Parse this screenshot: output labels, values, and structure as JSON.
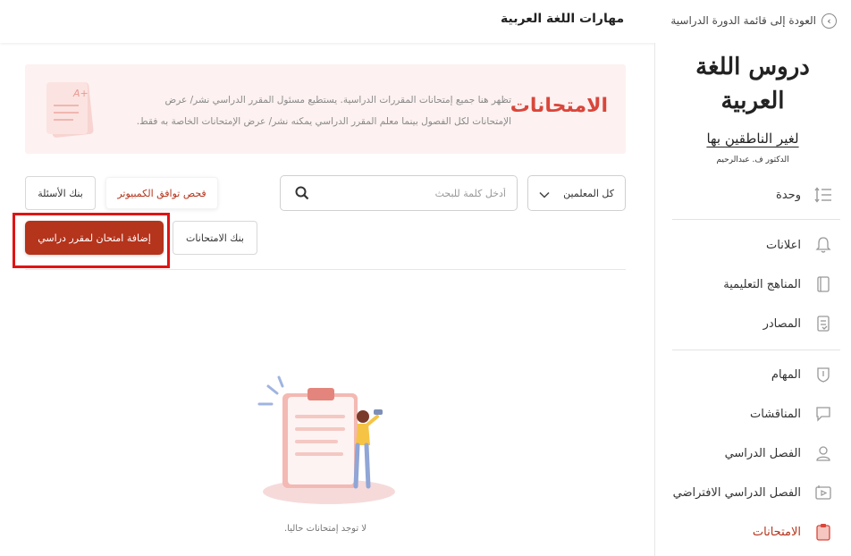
{
  "header": {
    "back_label": "العودة إلى قائمة الدورة الدراسية",
    "course_title": "مهارات اللغة العربية"
  },
  "logo": {
    "main_text": "دروس اللغة العربية",
    "sub_text": "لغير الناطقين بها",
    "author": "الدكتور ف. عبدالرحيم"
  },
  "sidebar": {
    "items": [
      {
        "label": "وحدة",
        "icon": "list-order-icon"
      },
      {
        "label": "اعلانات",
        "icon": "bell-icon"
      },
      {
        "label": "المناهج التعليمية",
        "icon": "book-icon"
      },
      {
        "label": "المصادر",
        "icon": "resources-icon"
      },
      {
        "label": "المهام",
        "icon": "shield-icon"
      },
      {
        "label": "المناقشات",
        "icon": "chat-icon"
      },
      {
        "label": "الفصل الدراسي",
        "icon": "person-icon"
      },
      {
        "label": "الفصل الدراسي الافتراضي",
        "icon": "video-icon"
      },
      {
        "label": "الامتحانات",
        "icon": "exam-icon",
        "active": true
      }
    ]
  },
  "banner": {
    "title": "الامتحانات",
    "description": "تظهر هنا جميع إمتحانات المقررات الدراسية. يستطيع مسئول المقرر الدراسي نشر/ عرض الإمتحانات لكل الفصول بينما معلم المقرر الدراسي يمكنه نشر/ عرض الإمتحانات الخاصة به فقط."
  },
  "toolbar": {
    "teacher_select": "كل المعلمين",
    "search_placeholder": "أدخل كلمة للبحث",
    "compat_check": "فحص توافق الكمبيوتر",
    "question_bank": "بنك الأسئلة",
    "exam_bank": "بنك الامتحانات",
    "add_exam": "إضافة امتحان لمقرر دراسي"
  },
  "empty_state": {
    "message": "لا توجد إمتحانات حاليا."
  },
  "colors": {
    "accent": "#b5341c",
    "banner_bg": "#fdf1f1",
    "banner_title": "#d9463b",
    "highlight": "#e01414"
  }
}
